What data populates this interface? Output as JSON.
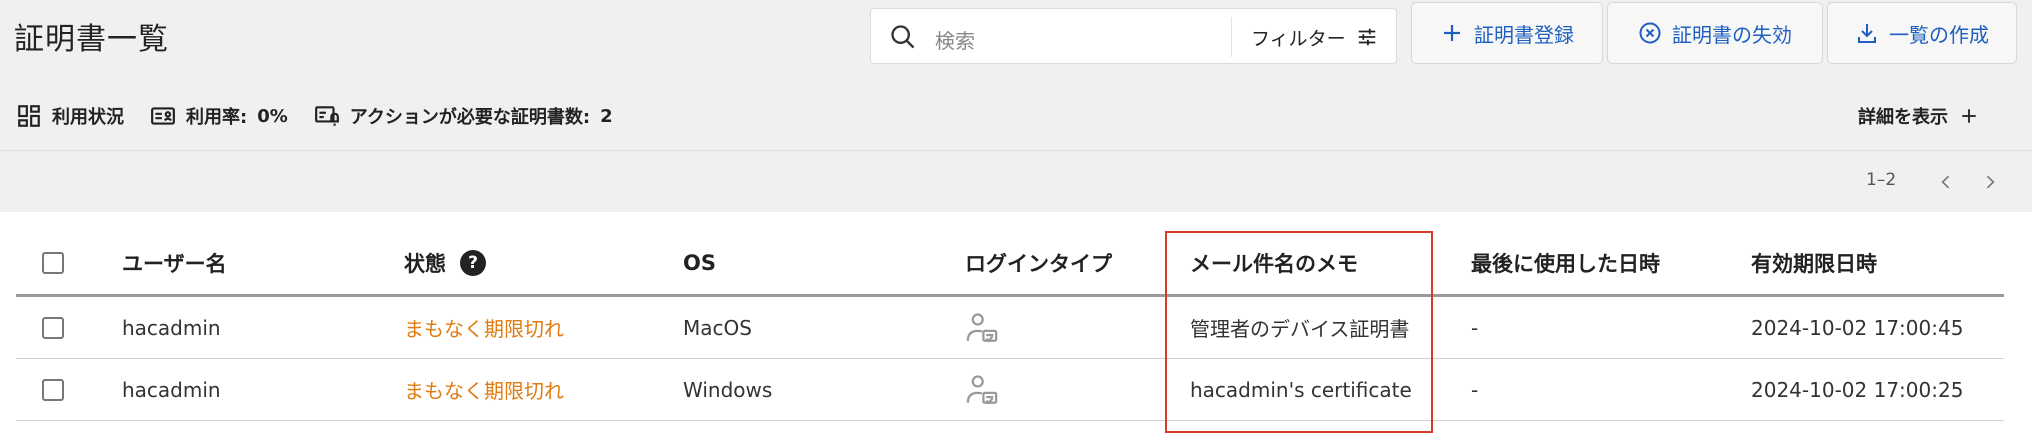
{
  "page_title": "証明書一覧",
  "search": {
    "placeholder": "検索",
    "filter_label": "フィルター"
  },
  "actions": {
    "register": "証明書登録",
    "revoke": "証明書の失効",
    "export": "一覧の作成"
  },
  "stats": {
    "usage_label": "利用状況",
    "rate_label": "利用率:",
    "rate_value": "0%",
    "action_label": "アクションが必要な証明書数:",
    "action_value": "2",
    "details_label": "詳細を表示"
  },
  "pager": {
    "range": "1–2"
  },
  "table": {
    "headers": {
      "username": "ユーザー名",
      "status": "状態",
      "os": "OS",
      "login_type": "ログインタイプ",
      "memo": "メール件名のメモ",
      "last_used": "最後に使用した日時",
      "expires": "有効期限日時"
    },
    "help_glyph": "?",
    "rows": [
      {
        "username": "hacadmin",
        "status": "まもなく期限切れ",
        "os": "MacOS",
        "memo": "管理者のデバイス証明書",
        "last_used": "-",
        "expires": "2024-10-02 17:00:45"
      },
      {
        "username": "hacadmin",
        "status": "まもなく期限切れ",
        "os": "Windows",
        "memo": "hacadmin's certificate",
        "last_used": "-",
        "expires": "2024-10-02 17:00:25"
      }
    ]
  },
  "colors": {
    "accent": "#1f5fbf",
    "warning": "#e07c12",
    "highlight": "#d8392b"
  }
}
